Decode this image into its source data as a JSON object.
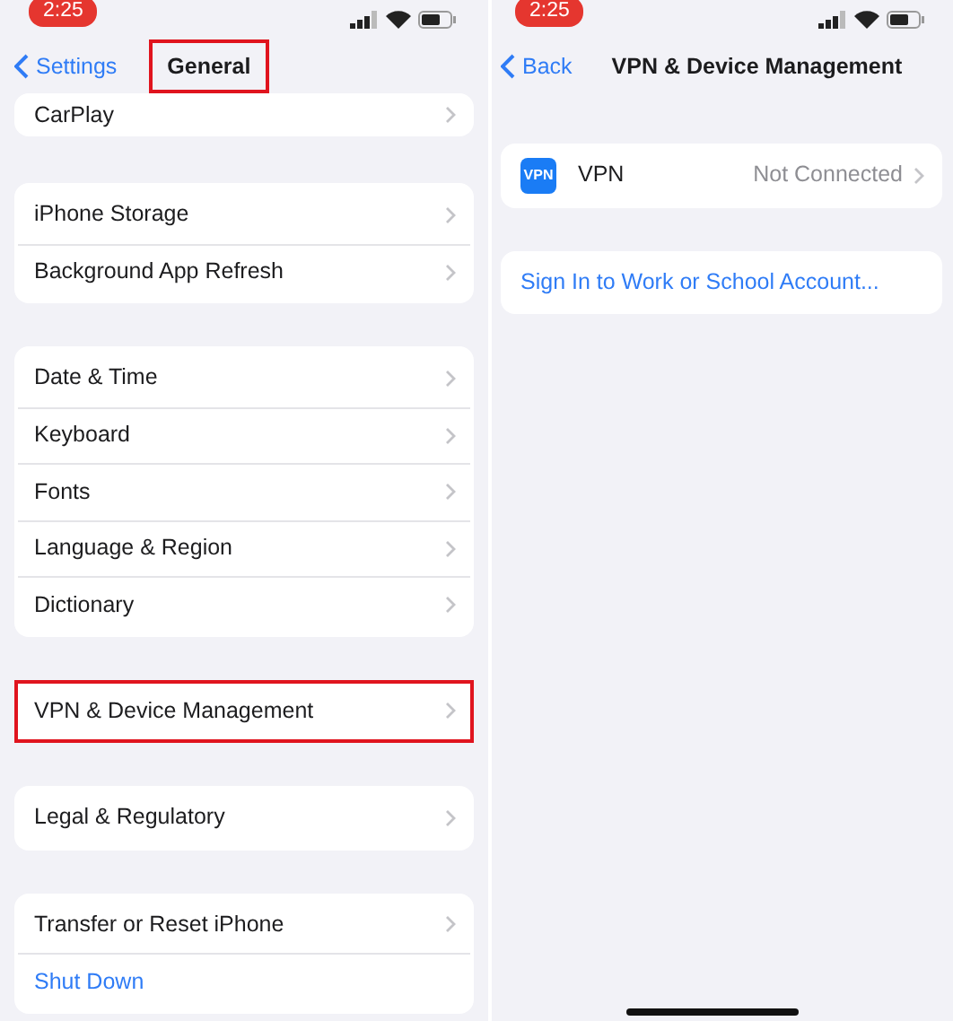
{
  "screens": [
    {
      "status_time": "2:25",
      "back_label": "Settings",
      "title": "General",
      "title_highlighted": true,
      "home_indicator": false,
      "groups": [
        {
          "highlighted": false,
          "rows": [
            {
              "kind": "nav",
              "label": "CarPlay"
            }
          ]
        },
        {
          "highlighted": false,
          "rows": [
            {
              "kind": "nav",
              "label": "iPhone Storage"
            },
            {
              "kind": "nav",
              "label": "Background App Refresh"
            }
          ]
        },
        {
          "highlighted": false,
          "rows": [
            {
              "kind": "nav",
              "label": "Date & Time"
            },
            {
              "kind": "nav",
              "label": "Keyboard"
            },
            {
              "kind": "nav",
              "label": "Fonts"
            },
            {
              "kind": "nav",
              "label": "Language & Region"
            },
            {
              "kind": "nav",
              "label": "Dictionary"
            }
          ]
        },
        {
          "highlighted": true,
          "rows": [
            {
              "kind": "nav",
              "label": "VPN & Device Management"
            }
          ]
        },
        {
          "highlighted": false,
          "rows": [
            {
              "kind": "nav",
              "label": "Legal & Regulatory"
            }
          ]
        },
        {
          "highlighted": false,
          "rows": [
            {
              "kind": "nav",
              "label": "Transfer or Reset iPhone"
            },
            {
              "kind": "action",
              "label": "Shut Down"
            }
          ]
        }
      ]
    },
    {
      "status_time": "2:25",
      "back_label": "Back",
      "title": "VPN & Device Management",
      "title_highlighted": false,
      "home_indicator": true,
      "groups": [
        {
          "highlighted": false,
          "rows": [
            {
              "kind": "icon_nav",
              "icon_text": "VPN",
              "label": "VPN",
              "value": "Not Connected"
            }
          ]
        },
        {
          "highlighted": false,
          "rows": [
            {
              "kind": "action",
              "label": "Sign In to Work or School Account..."
            }
          ]
        }
      ]
    }
  ]
}
